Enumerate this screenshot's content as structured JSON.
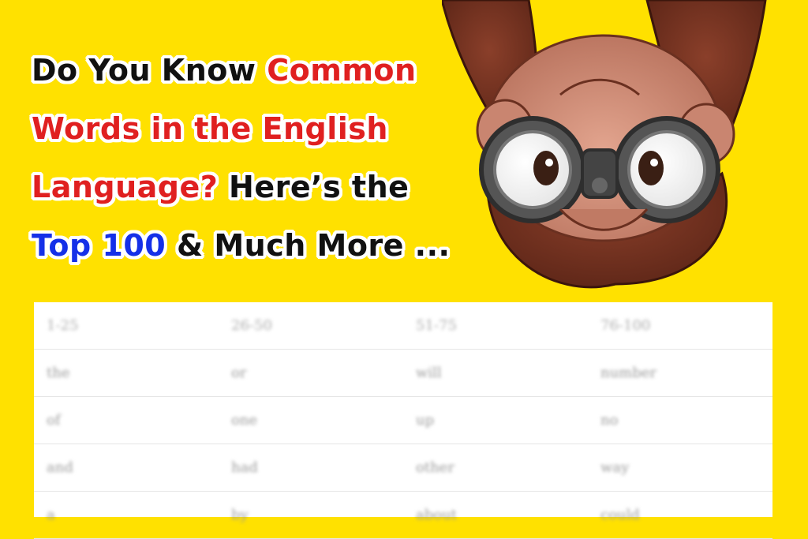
{
  "headline": {
    "lines": [
      [
        {
          "text": "Do You Know ",
          "color": "black"
        },
        {
          "text": "Common",
          "color": "red"
        }
      ],
      [
        {
          "text": "Words in the English",
          "color": "red"
        }
      ],
      [
        {
          "text": "Language?",
          "color": "red"
        },
        {
          "text": " Here’s the",
          "color": "black"
        }
      ],
      [
        {
          "text": "Top 100",
          "color": "blue"
        },
        {
          "text": " & Much More ...",
          "color": "black"
        }
      ]
    ]
  },
  "mascot": {
    "icon": "curious-monkey-binoculars-illustration"
  },
  "table": {
    "headers": [
      "1-25",
      "26-50",
      "51-75",
      "76-100"
    ],
    "rows": [
      [
        "the",
        "or",
        "will",
        "number"
      ],
      [
        "of",
        "one",
        "up",
        "no"
      ],
      [
        "and",
        "had",
        "other",
        "way"
      ],
      [
        "a",
        "by",
        "about",
        "could"
      ]
    ]
  }
}
